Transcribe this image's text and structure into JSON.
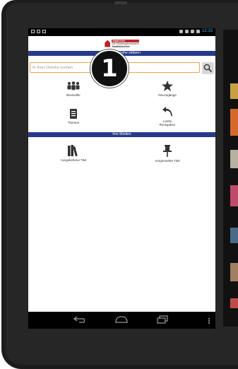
{
  "header": {
    "logo_line1": "Stadt Köln",
    "logo_line2": "Die Oberbürgermeisterin",
    "logo_line3": "Stadtbibliothek"
  },
  "sections": {
    "browse_title": "In Ihrer Onleihe stöbern",
    "media_title": "Ihre Medien"
  },
  "search": {
    "placeholder": "In Ihrer Onleihe suchen"
  },
  "tiles": {
    "bestseller": "Bestseller",
    "new_arrivals": "Neuzugänge",
    "topics": "Themen",
    "returns_line1": "Letzte",
    "returns_line2": "Rückgaben",
    "borrowed": "Ausgeliehene Titel",
    "reserved": "Vorgemerkte Titel"
  },
  "callout": {
    "number": "1"
  },
  "status": {
    "clock": "12:33"
  },
  "icons": {
    "bestseller": "people-icon",
    "new_arrivals": "star-icon",
    "topics": "list-icon",
    "returns": "return-arrow-icon",
    "borrowed": "books-icon",
    "reserved": "pin-icon",
    "search": "search-icon"
  },
  "colors": {
    "section_bar": "#263a8c",
    "search_border": "#e8a24a",
    "brand_red": "#c0272d"
  }
}
